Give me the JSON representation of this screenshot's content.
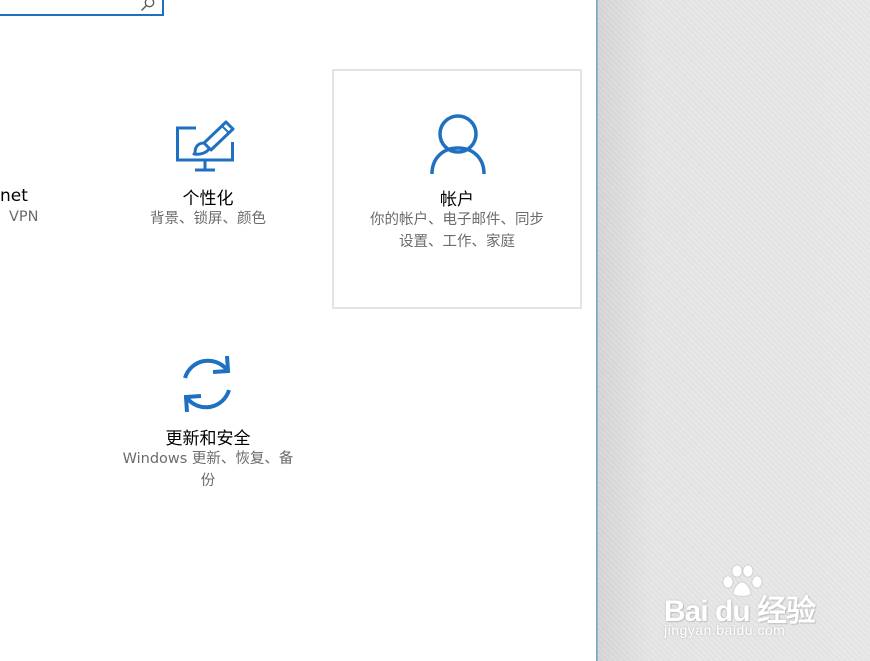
{
  "settings": {
    "tiles": [
      {
        "title": "个性化",
        "desc_lines": [
          "背景、锁屏、颜色"
        ],
        "icon": "personalization-icon"
      },
      {
        "title": "帐户",
        "desc_lines": [
          "你的帐户、电子邮件、同步",
          "设置、工作、家庭"
        ],
        "icon": "person-icon"
      },
      {
        "title": "更新和安全",
        "desc_lines": [
          "Windows 更新、恢复、备",
          "份"
        ],
        "icon": "sync-arrows-icon"
      }
    ],
    "partial_tile": {
      "title": "net",
      "desc": "VPN"
    }
  },
  "watermark": {
    "brand": "Bai du 经验",
    "url": "jingyan.baidu.com"
  },
  "colors": {
    "accent": "#1f70c1",
    "selected_border": "#e4e4e4",
    "desc_text": "#6b6b6b"
  }
}
